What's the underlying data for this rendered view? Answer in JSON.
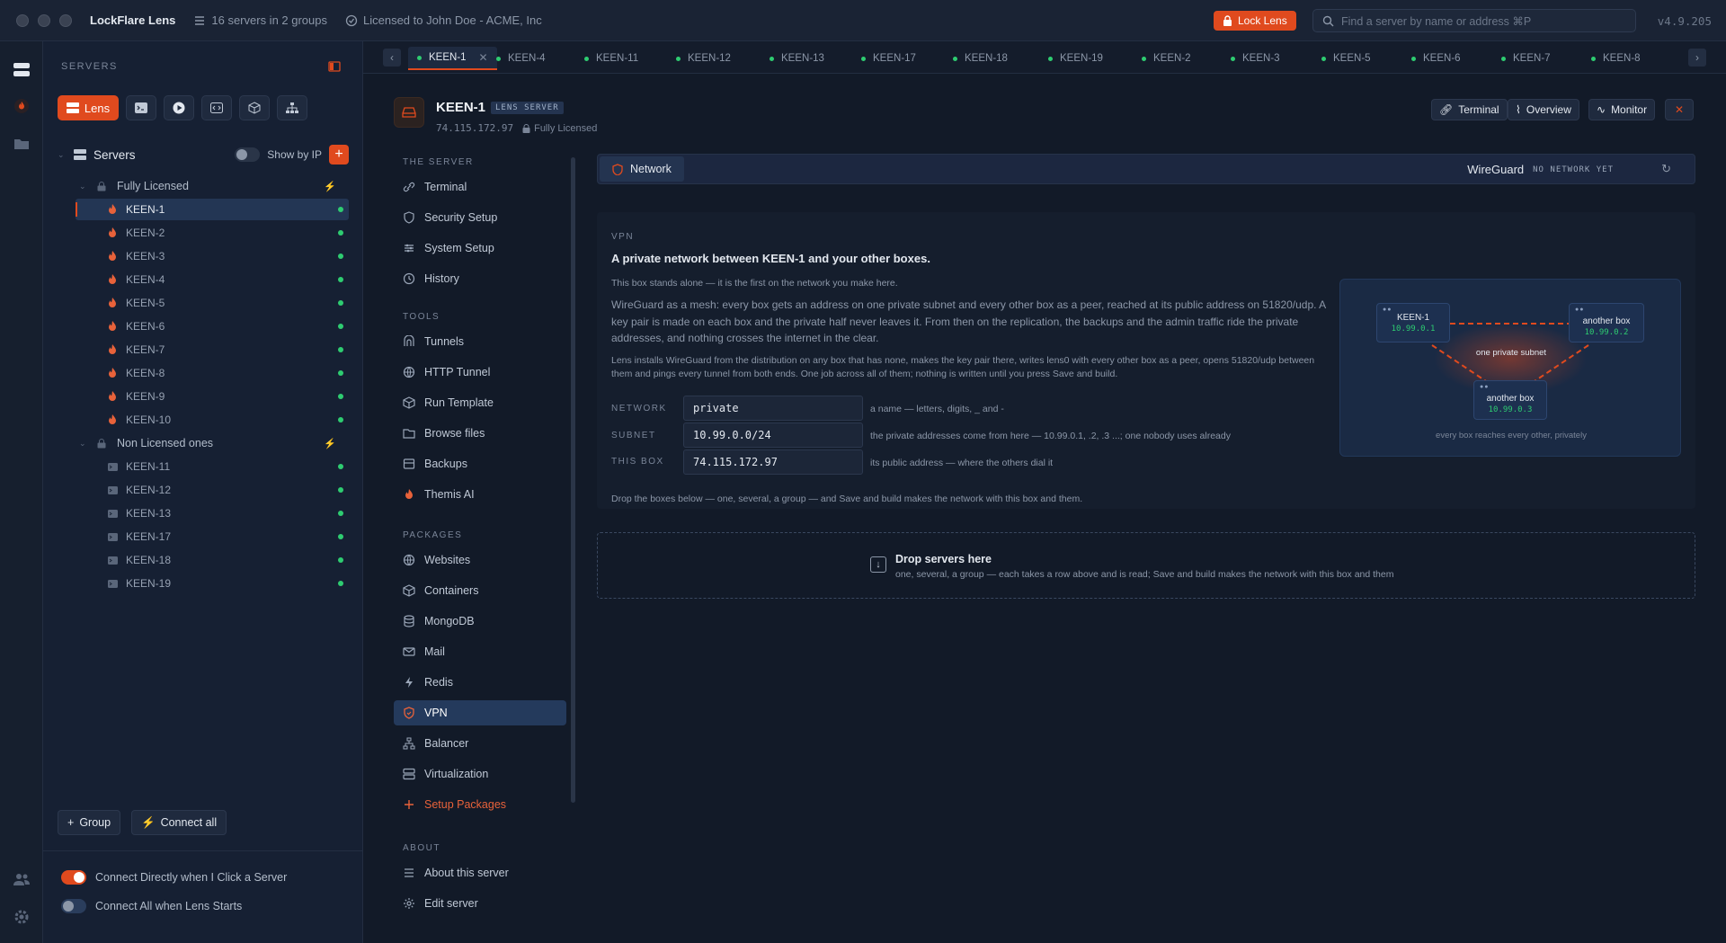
{
  "titlebar": {
    "app_name": "LockFlare Lens",
    "servers_summary": "16 servers in 2 groups",
    "license": "Licensed to John Doe - ACME, Inc",
    "lock_button": "Lock Lens",
    "search_placeholder": "Find a server by name or address ⌘P",
    "version": "v4.9.205"
  },
  "sidebar": {
    "header": "SERVERS",
    "lens_button": "Lens",
    "root_label": "Servers",
    "show_by_ip": "Show by IP",
    "groups": [
      {
        "name": "Fully Licensed",
        "servers": [
          "KEEN-1",
          "KEEN-2",
          "KEEN-3",
          "KEEN-4",
          "KEEN-5",
          "KEEN-6",
          "KEEN-7",
          "KEEN-8",
          "KEEN-9",
          "KEEN-10"
        ]
      },
      {
        "name": "Non Licensed ones",
        "servers": [
          "KEEN-11",
          "KEEN-12",
          "KEEN-13",
          "KEEN-17",
          "KEEN-18",
          "KEEN-19"
        ]
      }
    ],
    "group_button": "Group",
    "connect_all_button": "Connect all",
    "setting_connect_direct": "Connect Directly when I Click a Server",
    "setting_connect_all": "Connect All when Lens Starts"
  },
  "tabs": [
    "KEEN-1",
    "KEEN-4",
    "KEEN-11",
    "KEEN-12",
    "KEEN-13",
    "KEEN-17",
    "KEEN-18",
    "KEEN-19",
    "KEEN-2",
    "KEEN-3",
    "KEEN-5",
    "KEEN-6",
    "KEEN-7",
    "KEEN-8"
  ],
  "server": {
    "name": "KEEN-1",
    "badge": "LENS SERVER",
    "ip": "74.115.172.97",
    "license": "Fully Licensed",
    "buttons": {
      "terminal": "Terminal",
      "overview": "Overview",
      "monitor": "Monitor"
    }
  },
  "nav": {
    "the_server": "THE SERVER",
    "tools": "TOOLS",
    "packages": "PACKAGES",
    "about": "ABOUT",
    "server_items": [
      "Terminal",
      "Security Setup",
      "System Setup",
      "History"
    ],
    "tool_items": [
      "Tunnels",
      "HTTP Tunnel",
      "Run Template",
      "Browse files",
      "Backups",
      "Themis AI"
    ],
    "package_items": [
      "Websites",
      "Containers",
      "MongoDB",
      "Mail",
      "Redis",
      "VPN",
      "Balancer",
      "Virtualization",
      "Setup Packages"
    ],
    "about_items": [
      "About this server",
      "Edit server"
    ]
  },
  "network_bar": {
    "tab": "Network",
    "wireguard": "WireGuard",
    "status": "NO NETWORK YET"
  },
  "vpn": {
    "eyebrow": "VPN",
    "title": "A private network between KEEN-1 and your other boxes.",
    "alone": "This box stands alone — it is the first on the network you make here.",
    "paragraph": "WireGuard as a mesh: every box gets an address on one private subnet and every other box as a peer, reached at its public address on 51820/udp. A key pair is made on each box and the private half never leaves it. From then on the replication, the backups and the admin traffic ride the private addresses, and nothing crosses the internet in the clear.",
    "install_note": "Lens installs WireGuard from the distribution on any box that has none, makes the key pair there, writes lens0 with every other box as a peer, opens 51820/udp between them and pings every tunnel from both ends. One job across all of them; nothing is written until you press Save and build.",
    "fields": {
      "network_label": "NETWORK",
      "network_value": "private",
      "network_hint": "a name — letters, digits, _ and -",
      "subnet_label": "SUBNET",
      "subnet_value": "10.99.0.0/24",
      "subnet_hint": "the private addresses come from here — 10.99.0.1, .2, .3 ...; one nobody uses already",
      "box_label": "THIS BOX",
      "box_value": "74.115.172.97",
      "box_hint": "its public address — where the others dial it"
    },
    "drop_note": "Drop the boxes below — one, several, a group — and Save and build makes the network with this box and them.",
    "diagram": {
      "node1_name": "KEEN-1",
      "node1_ip": "10.99.0.1",
      "node2_name": "another box",
      "node2_ip": "10.99.0.2",
      "node3_name": "another box",
      "node3_ip": "10.99.0.3",
      "center": "one private subnet",
      "caption": "every box reaches every other, privately"
    }
  },
  "dropzone": {
    "title": "Drop servers here",
    "subtitle": "one, several, a group — each takes a row above and is read; Save and build makes the network with this box and them"
  },
  "colors": {
    "accent": "#e04a1e",
    "online": "#2ecc71",
    "background": "#121a28"
  }
}
